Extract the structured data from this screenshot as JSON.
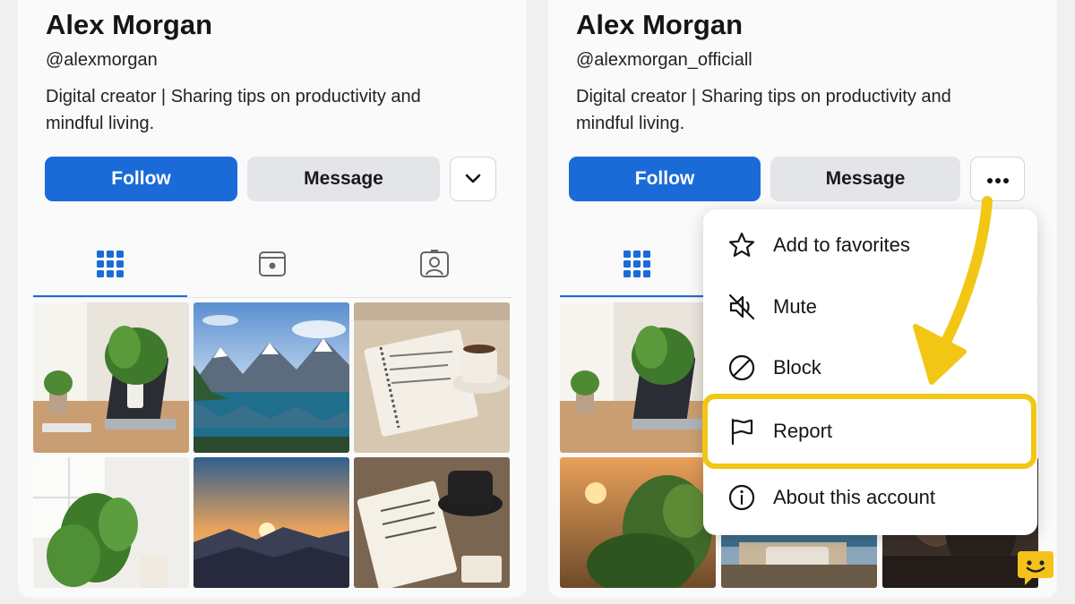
{
  "colors": {
    "accent": "#1a6bd8",
    "highlight": "#f2c614",
    "button_secondary": "#e4e5e9"
  },
  "left_profile": {
    "name": "Alex Morgan",
    "handle": "@alexmorgan",
    "bio": "Digital creator | Sharing tips on productivity and mindful living.",
    "follow_label": "Follow",
    "message_label": "Message",
    "more_icon": "chevron-down-icon",
    "tabs": [
      {
        "icon": "grid-icon",
        "active": true
      },
      {
        "icon": "reels-icon",
        "active": false
      },
      {
        "icon": "tagged-icon",
        "active": false
      }
    ],
    "posts": [
      "desk-plant-laptop",
      "mountain-lake",
      "notebook-coffee",
      "window-plant",
      "sunset-mountains",
      "journal-coffee"
    ]
  },
  "right_profile": {
    "name": "Alex Morgan",
    "handle": "@alexmorgan_officiall",
    "bio": "Digital creator | Sharing tips on productivity and mindful living.",
    "follow_label": "Follow",
    "message_label": "Message",
    "more_icon": "more-dots-icon",
    "posts": [
      "desk-plant-laptop",
      "sunset-forest",
      "seaside-terrace",
      "dark-portrait"
    ]
  },
  "menu": {
    "items": [
      {
        "label": "Add to favorites",
        "icon": "star-icon"
      },
      {
        "label": "Mute",
        "icon": "mute-icon"
      },
      {
        "label": "Block",
        "icon": "block-icon"
      },
      {
        "label": "Report",
        "icon": "flag-icon",
        "highlighted": true
      },
      {
        "label": "About this account",
        "icon": "info-icon"
      }
    ]
  }
}
